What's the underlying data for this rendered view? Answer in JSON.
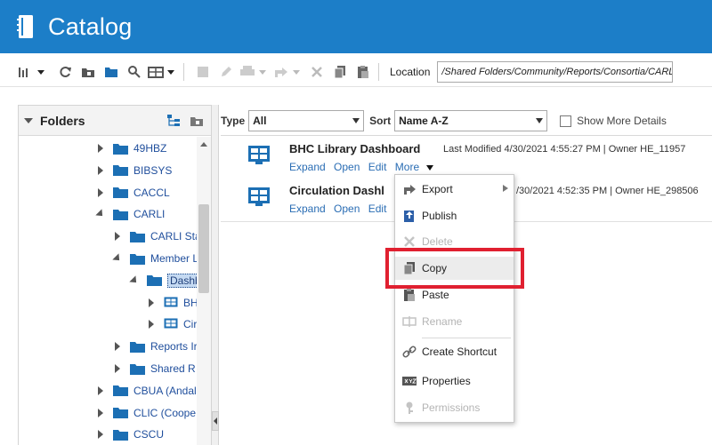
{
  "header": {
    "title": "Catalog",
    "bg_color": "#1c7ec8"
  },
  "toolbar": {
    "location_label": "Location",
    "location_value": "/Shared Folders/Community/Reports/Consortia/CARLI"
  },
  "folders": {
    "title": "Folders",
    "tree": [
      {
        "label": "49HBZ",
        "kind": "folder",
        "state": "collapsed",
        "depth": 0
      },
      {
        "label": "BIBSYS",
        "kind": "folder",
        "state": "collapsed",
        "depth": 0
      },
      {
        "label": "CACCL",
        "kind": "folder",
        "state": "collapsed",
        "depth": 0
      },
      {
        "label": "CARLI",
        "kind": "folder",
        "state": "expanded",
        "depth": 0
      },
      {
        "label": "CARLI Sta",
        "kind": "folder",
        "state": "collapsed",
        "depth": 1
      },
      {
        "label": "Member L",
        "kind": "folder",
        "state": "expanded",
        "depth": 1
      },
      {
        "label": "Dashb",
        "kind": "folder",
        "state": "expanded",
        "depth": 2,
        "selected": true
      },
      {
        "label": "BH",
        "kind": "dashboard",
        "state": "collapsed",
        "depth": 3
      },
      {
        "label": "Cir",
        "kind": "dashboard",
        "state": "collapsed",
        "depth": 3
      },
      {
        "label": "Reports Ir",
        "kind": "folder",
        "state": "collapsed",
        "depth": 1
      },
      {
        "label": "Shared R",
        "kind": "folder",
        "state": "collapsed",
        "depth": 1
      },
      {
        "label": "CBUA (Andal",
        "kind": "folder",
        "state": "collapsed",
        "depth": 0
      },
      {
        "label": "CLIC (Coope",
        "kind": "folder",
        "state": "collapsed",
        "depth": 0
      },
      {
        "label": "CSCU",
        "kind": "folder",
        "state": "collapsed",
        "depth": 0
      }
    ]
  },
  "filters": {
    "type_label": "Type",
    "type_value": "All",
    "sort_label": "Sort",
    "sort_value": "Name A-Z",
    "show_more_label": "Show More Details"
  },
  "items": [
    {
      "name": "BHC Library Dashboard",
      "meta": "Last Modified 4/30/2021 4:55:27 PM  |  Owner HE_11957",
      "links": [
        "Expand",
        "Open",
        "Edit",
        "More"
      ]
    },
    {
      "name": "Circulation Dashl",
      "meta": "/30/2021 4:52:35 PM  |  Owner HE_298506",
      "links": [
        "Expand",
        "Open",
        "Edit"
      ]
    }
  ],
  "menu": {
    "items": [
      {
        "label": "Export",
        "icon": "export-icon",
        "disabled": false,
        "submenu": true
      },
      {
        "label": "Publish",
        "icon": "publish-icon",
        "disabled": false
      },
      {
        "label": "Delete",
        "icon": "delete-icon",
        "disabled": true
      },
      {
        "label": "Copy",
        "icon": "copy-icon",
        "disabled": false,
        "highlighted": true
      },
      {
        "label": "Paste",
        "icon": "paste-icon",
        "disabled": false
      },
      {
        "label": "Rename",
        "icon": "rename-icon",
        "disabled": true
      },
      {
        "label": "Create Shortcut",
        "icon": "shortcut-icon",
        "disabled": false
      },
      {
        "label": "Properties",
        "icon": "properties-icon",
        "disabled": false
      },
      {
        "label": "Permissions",
        "icon": "permissions-icon",
        "disabled": true
      }
    ]
  },
  "annotation_color": "#e02030"
}
